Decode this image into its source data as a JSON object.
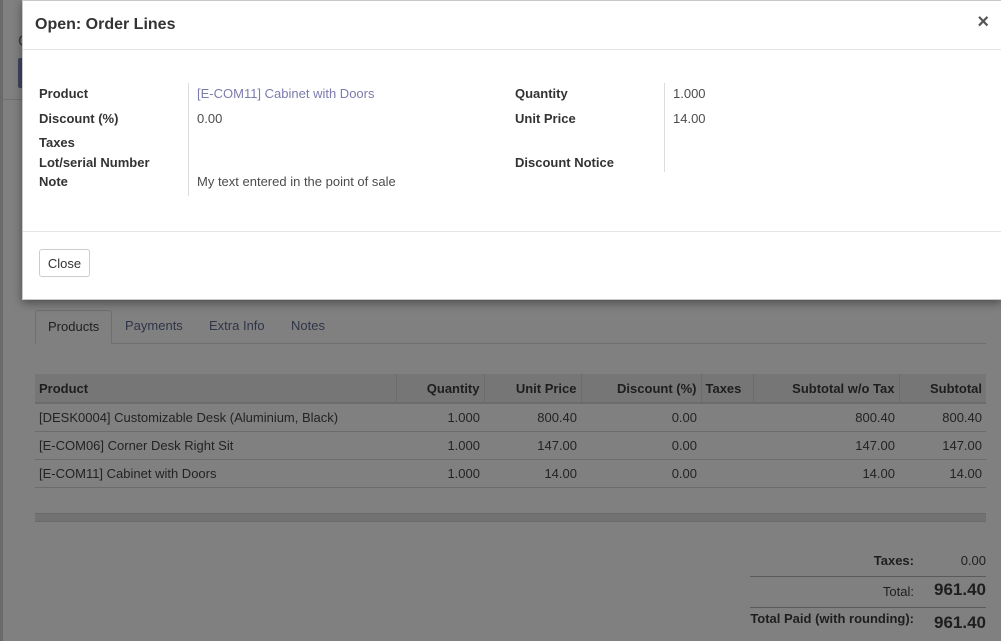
{
  "dialog": {
    "title": "Open: Order Lines",
    "close_symbol": "×",
    "fields": {
      "product_label": "Product",
      "product_value": "[E-COM11] Cabinet with Doors",
      "discount_label": "Discount (%)",
      "discount_value": "0.00",
      "taxes_label": "Taxes",
      "lot_label": "Lot/serial Number",
      "note_label": "Note",
      "note_value": "My text entered in the point of sale",
      "quantity_label": "Quantity",
      "quantity_value": "1.000",
      "unit_price_label": "Unit Price",
      "unit_price_value": "14.00",
      "discount_notice_label": "Discount Notice"
    },
    "close_button": "Close"
  },
  "background": {
    "fragment_text": "C",
    "tabs": [
      "Products",
      "Payments",
      "Extra Info",
      "Notes"
    ],
    "active_tab": "Products",
    "table": {
      "headers": [
        "Product",
        "Quantity",
        "Unit Price",
        "Discount (%)",
        "Taxes",
        "Subtotal w/o Tax",
        "Subtotal"
      ],
      "rows": [
        [
          "[DESK0004] Customizable Desk (Aluminium, Black)",
          "1.000",
          "800.40",
          "0.00",
          "",
          "800.40",
          "800.40"
        ],
        [
          "[E-COM06] Corner Desk Right Sit",
          "1.000",
          "147.00",
          "0.00",
          "",
          "147.00",
          "147.00"
        ],
        [
          "[E-COM11] Cabinet with Doors",
          "1.000",
          "14.00",
          "0.00",
          "",
          "14.00",
          "14.00"
        ]
      ]
    },
    "totals": {
      "taxes_label": "Taxes:",
      "taxes_value": "0.00",
      "total_label": "Total:",
      "total_value": "961.40",
      "paid_label": "Total Paid (with rounding):",
      "paid_value": "961.40"
    }
  },
  "colors": {
    "link": "#7c7bad",
    "overlay": "#808080"
  }
}
